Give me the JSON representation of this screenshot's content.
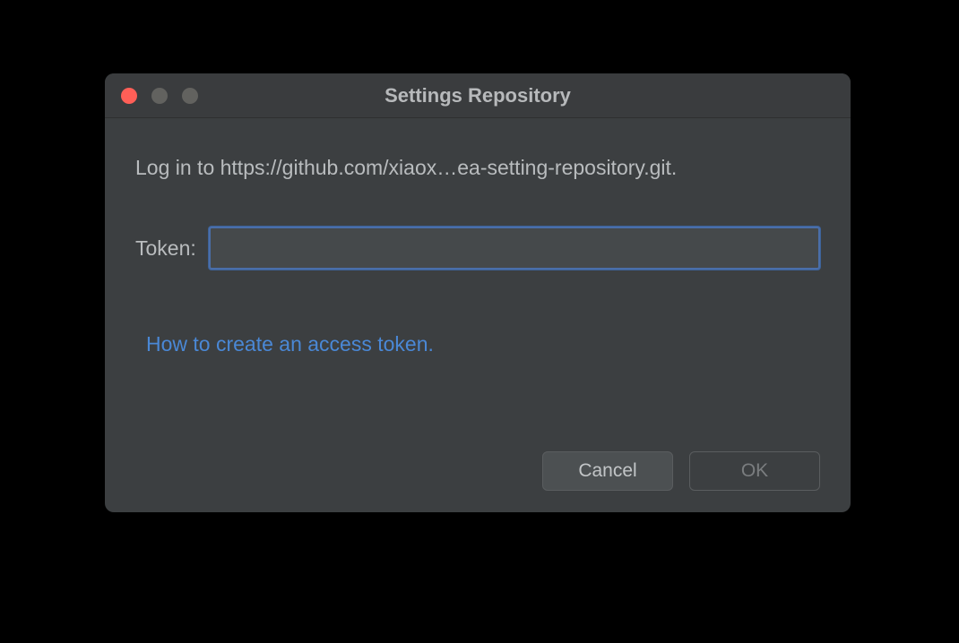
{
  "titlebar": {
    "title": "Settings Repository"
  },
  "content": {
    "login_text": "Log in to https://github.com/xiaox…ea-setting-repository.git.",
    "token_label": "Token:",
    "token_value": "",
    "help_link_text": "How to create an access token."
  },
  "buttons": {
    "cancel_label": "Cancel",
    "ok_label": "OK"
  }
}
